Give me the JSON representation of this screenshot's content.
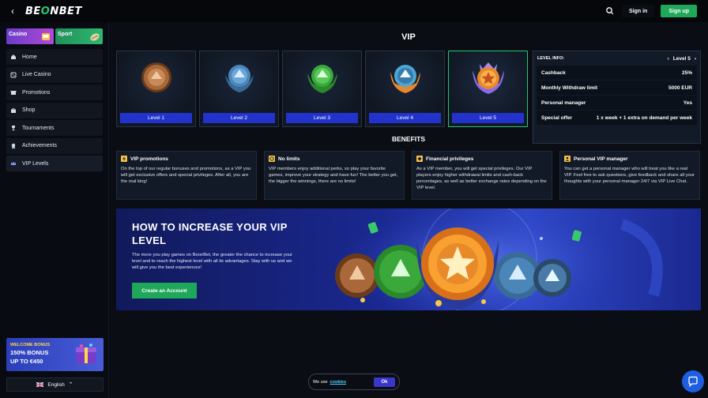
{
  "header": {
    "back_icon": "chevron-left-icon",
    "logo": "BEONBET",
    "search_icon": "search-icon",
    "signin_label": "Sign in",
    "signup_label": "Sign up"
  },
  "sidebar": {
    "tabs": [
      {
        "label": "Casino"
      },
      {
        "label": "Sport"
      }
    ],
    "items": [
      {
        "label": "Home",
        "icon": "home-icon"
      },
      {
        "label": "Live Casino",
        "icon": "live-casino-icon"
      },
      {
        "label": "Promotions",
        "icon": "promotions-icon"
      },
      {
        "label": "Shop",
        "icon": "shop-icon"
      },
      {
        "label": "Tournaments",
        "icon": "trophy-icon"
      },
      {
        "label": "Achievements",
        "icon": "achievements-icon"
      },
      {
        "label": "VIP Levels",
        "icon": "crown-icon"
      }
    ],
    "active_item": "VIP Levels",
    "bonus": {
      "small": "WELCOME BONUS",
      "line1": "150% BONUS",
      "line2": "UP TO €450"
    },
    "language": "English"
  },
  "main": {
    "title": "VIP",
    "levels": [
      {
        "label": "Level 1",
        "color": "#a8683a"
      },
      {
        "label": "Level 2",
        "color": "#4a86b8"
      },
      {
        "label": "Level 3",
        "color": "#3aa83a"
      },
      {
        "label": "Level 4",
        "color": "#4aa8d8"
      },
      {
        "label": "Level 5",
        "color": "#e8882a"
      }
    ],
    "active_level": "Level 5",
    "level_info": {
      "heading": "LEVEL INFO:",
      "current": "Level 5",
      "rows": [
        {
          "label": "Cashback",
          "value": "25%"
        },
        {
          "label": "Monthly Withdraw limit",
          "value": "5000 EUR"
        },
        {
          "label": "Personal manager",
          "value": "Yes"
        },
        {
          "label": "Special offer",
          "value": "1 x week + 1 extra on demand per week"
        }
      ]
    },
    "benefits_title": "BENEFITS",
    "benefits": [
      {
        "title": "VIP promotions",
        "icon": "lightning-icon",
        "text": "On the top of our regular bonuses and promotions, as a VIP you will get exclusive offers and special privileges. After all, you are the real king!"
      },
      {
        "title": "No limits",
        "icon": "coin-icon",
        "text": "VIP members enjoy additional perks, so play your favorite games, improve your strategy and have fun! The better you get, the bigger the winnings, there are no limits!"
      },
      {
        "title": "Financial privileges",
        "icon": "diamond-icon",
        "text": "As a VIP member, you will get special privileges. Our VIP players enjoy higher withdrawal limits and cash-back percentages, as well as better exchange rates depending on the VIP level."
      },
      {
        "title": "Personal VIP manager",
        "icon": "manager-icon",
        "text": "You can get a personal manager who will treat you like a real VIP. Feel free to ask questions, give feedback and share all your thoughts with your personal manager 24/7 via VIP Live Chat."
      }
    ],
    "promo": {
      "title": "HOW TO INCREASE YOUR VIP LEVEL",
      "text": "The more you play games on BeonBet, the greater the chance to increase your level and to reach the highest level with all its advantages. Stay with us and we will give you the best experiences!",
      "button": "Create an Account"
    }
  },
  "cookie": {
    "prefix": "We use",
    "link": "cookies",
    "ok": "Ok"
  },
  "chat_icon": "chat-icon"
}
